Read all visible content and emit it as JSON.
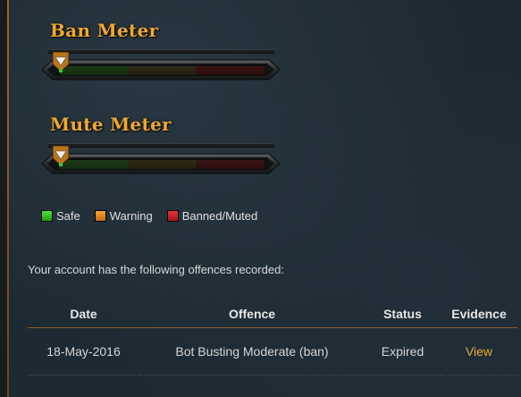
{
  "ban_meter": {
    "title": "Ban Meter",
    "level": 0.0
  },
  "mute_meter": {
    "title": "Mute Meter",
    "level": 0.0
  },
  "legend": [
    {
      "label": "Safe",
      "color": "#3cc82a"
    },
    {
      "label": "Warning",
      "color": "#e88c22"
    },
    {
      "label": "Banned/Muted",
      "color": "#cc2228"
    }
  ],
  "offences": {
    "intro": "Your account has the following offences recorded:",
    "headers": {
      "date": "Date",
      "offence": "Offence",
      "status": "Status",
      "evidence": "Evidence"
    },
    "rows": [
      {
        "date": "18-May-2016",
        "offence": "Bot Busting Moderate (ban)",
        "status": "Expired",
        "evidence": "View"
      }
    ]
  },
  "colors": {
    "accent": "#f0a830",
    "background": "#1e2a33"
  }
}
